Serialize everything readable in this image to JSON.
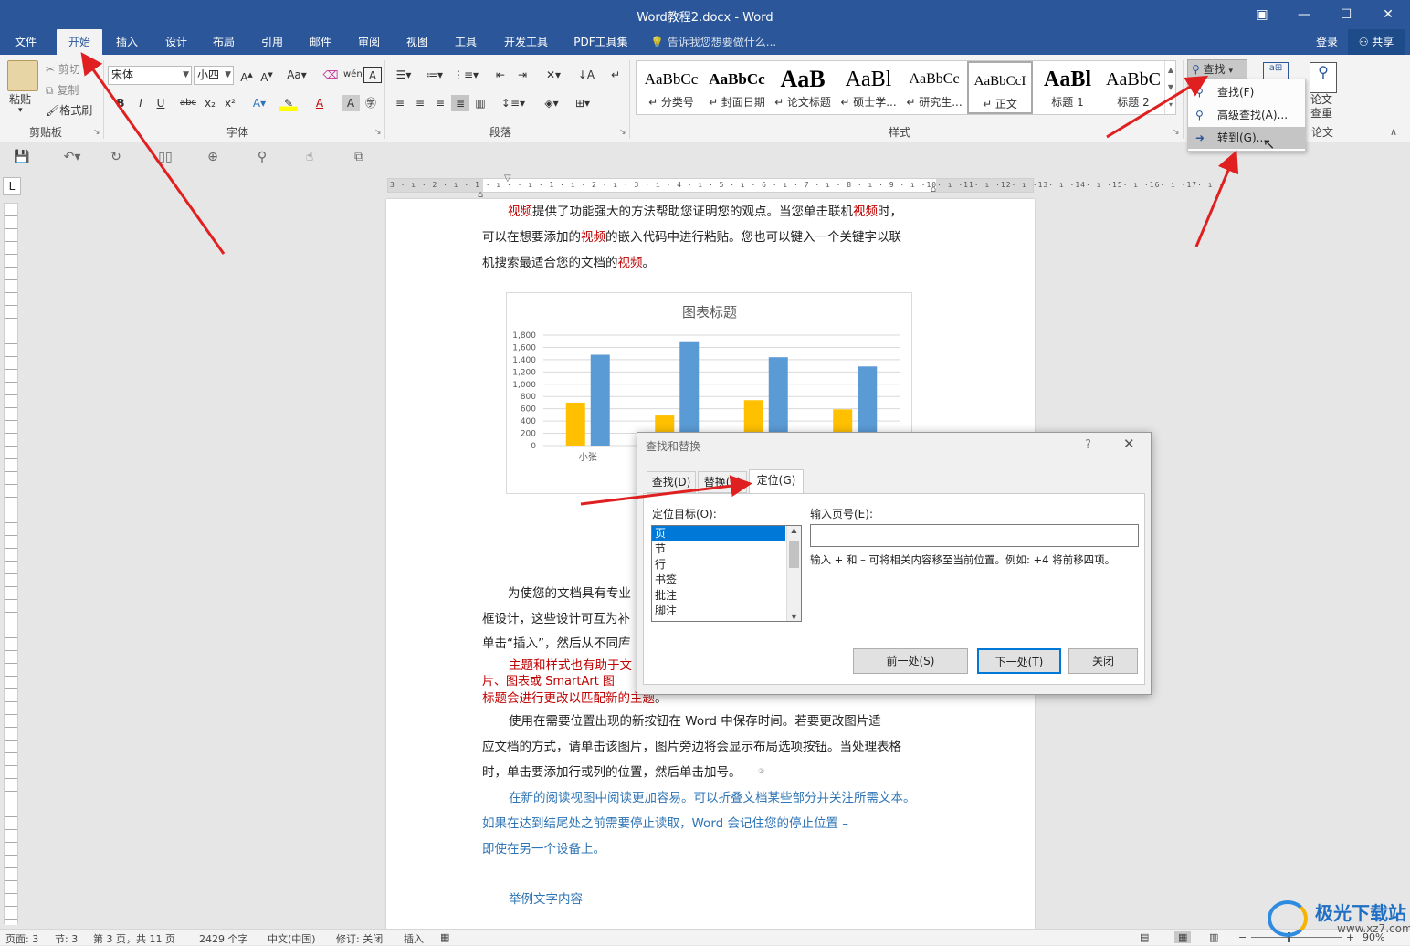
{
  "window": {
    "title": "Word教程2.docx - Word"
  },
  "tabs": [
    "文件",
    "开始",
    "插入",
    "设计",
    "布局",
    "引用",
    "邮件",
    "审阅",
    "视图",
    "工具",
    "开发工具",
    "PDF工具集"
  ],
  "tell_me": "告诉我您想要做什么...",
  "account": {
    "login": "登录",
    "share": "共享"
  },
  "ribbon": {
    "clipboard": {
      "paste": "粘贴",
      "cut": "剪切",
      "copy": "复制",
      "format_painter": "格式刷",
      "label": "剪贴板"
    },
    "font": {
      "name": "宋体",
      "size": "小四",
      "label": "字体"
    },
    "paragraph": {
      "label": "段落"
    },
    "styles": {
      "label": "样式",
      "items": [
        {
          "preview": "AaBbCc",
          "name": "↵ 分类号"
        },
        {
          "preview": "AaBbCc",
          "name": "↵ 封面日期"
        },
        {
          "preview": "AaB",
          "name": "↵ 论文标题"
        },
        {
          "preview": "AaBl",
          "name": "↵ 硕士学..."
        },
        {
          "preview": "AaBbCc",
          "name": "↵ 研究生..."
        },
        {
          "preview": "AaBbCcI",
          "name": "↵ 正文"
        },
        {
          "preview": "AaBl",
          "name": "标题 1"
        },
        {
          "preview": "AaBbC",
          "name": "标题 2"
        }
      ]
    },
    "find": {
      "label": "查找"
    },
    "paper": {
      "line1": "论文",
      "line2": "查重",
      "group": "论文"
    }
  },
  "find_menu": [
    {
      "label": "查找(F)"
    },
    {
      "label": "高级查找(A)..."
    },
    {
      "label": "转到(G)..."
    }
  ],
  "document": {
    "p1": [
      [
        {
          "t": "视频",
          "c": "red"
        },
        {
          "t": "提供了功能强大的方法帮助您证明您的观点。当您单击联机"
        },
        {
          "t": "视频",
          "c": "red"
        },
        {
          "t": "时，"
        }
      ],
      [
        {
          "t": "可以在想要添加的"
        },
        {
          "t": "视频",
          "c": "red"
        },
        {
          "t": "的嵌入代码中进行粘贴。您也可以键入一个关键字以联"
        }
      ],
      [
        {
          "t": "机搜索最适合您的文档的"
        },
        {
          "t": "视频",
          "c": "red"
        },
        {
          "t": "。"
        }
      ]
    ],
    "p2_lines": [
      "为使您的文档具有专业",
      "框设计，这些设计可互为补",
      "单击“插入”，然后从不同库"
    ],
    "p3_red_lines": [
      "主题和样式也有助于文",
      "片、图表或  SmartArt  图",
      "标题会进行更改以匹配新的主题"
    ],
    "p3_tail": "。",
    "p4_lines": [
      "使用在需要位置出现的新按钮在  Word 中保存时间。若要更改图片适",
      "应文档的方式，请单击该图片，图片旁边将会显示布局选项按钮。当处理表格",
      "时，单击要添加行或列的位置，然后单击加号。"
    ],
    "p5_blue_lines": [
      "在新的阅读视图中阅读更加容易。可以折叠文档某些部分并关注所需文本。",
      "如果在达到结尾处之前需要停止读取，Word  会记住您的停止位置  –",
      "即使在另一个设备上。"
    ],
    "p6": "举例文字内容"
  },
  "chart_data": {
    "type": "bar",
    "title": "图表标题",
    "categories": [
      "小张",
      "",
      "",
      ""
    ],
    "ylim": [
      0,
      1800
    ],
    "yticks": [
      "0",
      "200",
      "400",
      "600",
      "800",
      "1,000",
      "1,200",
      "1,400",
      "1,600",
      "1,800"
    ],
    "series": [
      {
        "values": [
          700,
          490,
          740,
          590
        ],
        "color": "#ffc000"
      },
      {
        "values": [
          1480,
          1700,
          1440,
          1290
        ],
        "color": "#5b9bd5"
      }
    ]
  },
  "dialog": {
    "title": "查找和替换",
    "help": "?",
    "tabs": [
      "查找(D)",
      "替换(P)",
      "定位(G)"
    ],
    "target_label": "定位目标(O):",
    "targets": [
      "页",
      "节",
      "行",
      "书签",
      "批注",
      "脚注"
    ],
    "page_label": "输入页号(E):",
    "page_value": "",
    "hint": "输入 + 和 – 可将相关内容移至当前位置。例如: +4 将前移四项。",
    "buttons": {
      "prev": "前一处(S)",
      "next": "下一处(T)",
      "close": "关闭"
    }
  },
  "status": {
    "page": "页面: 3",
    "section": "节: 3",
    "pages": "第 3 页，共 11 页",
    "words": "2429 个字",
    "lang": "中文(中国)",
    "track": "修订: 关闭",
    "mode": "插入",
    "zoom": "90%"
  },
  "ruler_text": "3 · ı · 2 · ı · 1 · ı ·  · ı · 1 · ı · 2 · ı · 3 · ı · 4 · ı · 5 · ı · 6 · ı · 7 · ı · 8 · ı · 9 · ı ·10· ı ·11· ı ·12· ı ·13· ı ·14· ı ·15· ı ·16· ı ·17· ı ·",
  "watermark": {
    "line1": "极光下载站",
    "line2": "www.xz7.com"
  },
  "colors": {
    "brand": "#2b579a",
    "red_text": "#c00000",
    "blue_text": "#2e74b5",
    "arrow": "#e02020"
  }
}
